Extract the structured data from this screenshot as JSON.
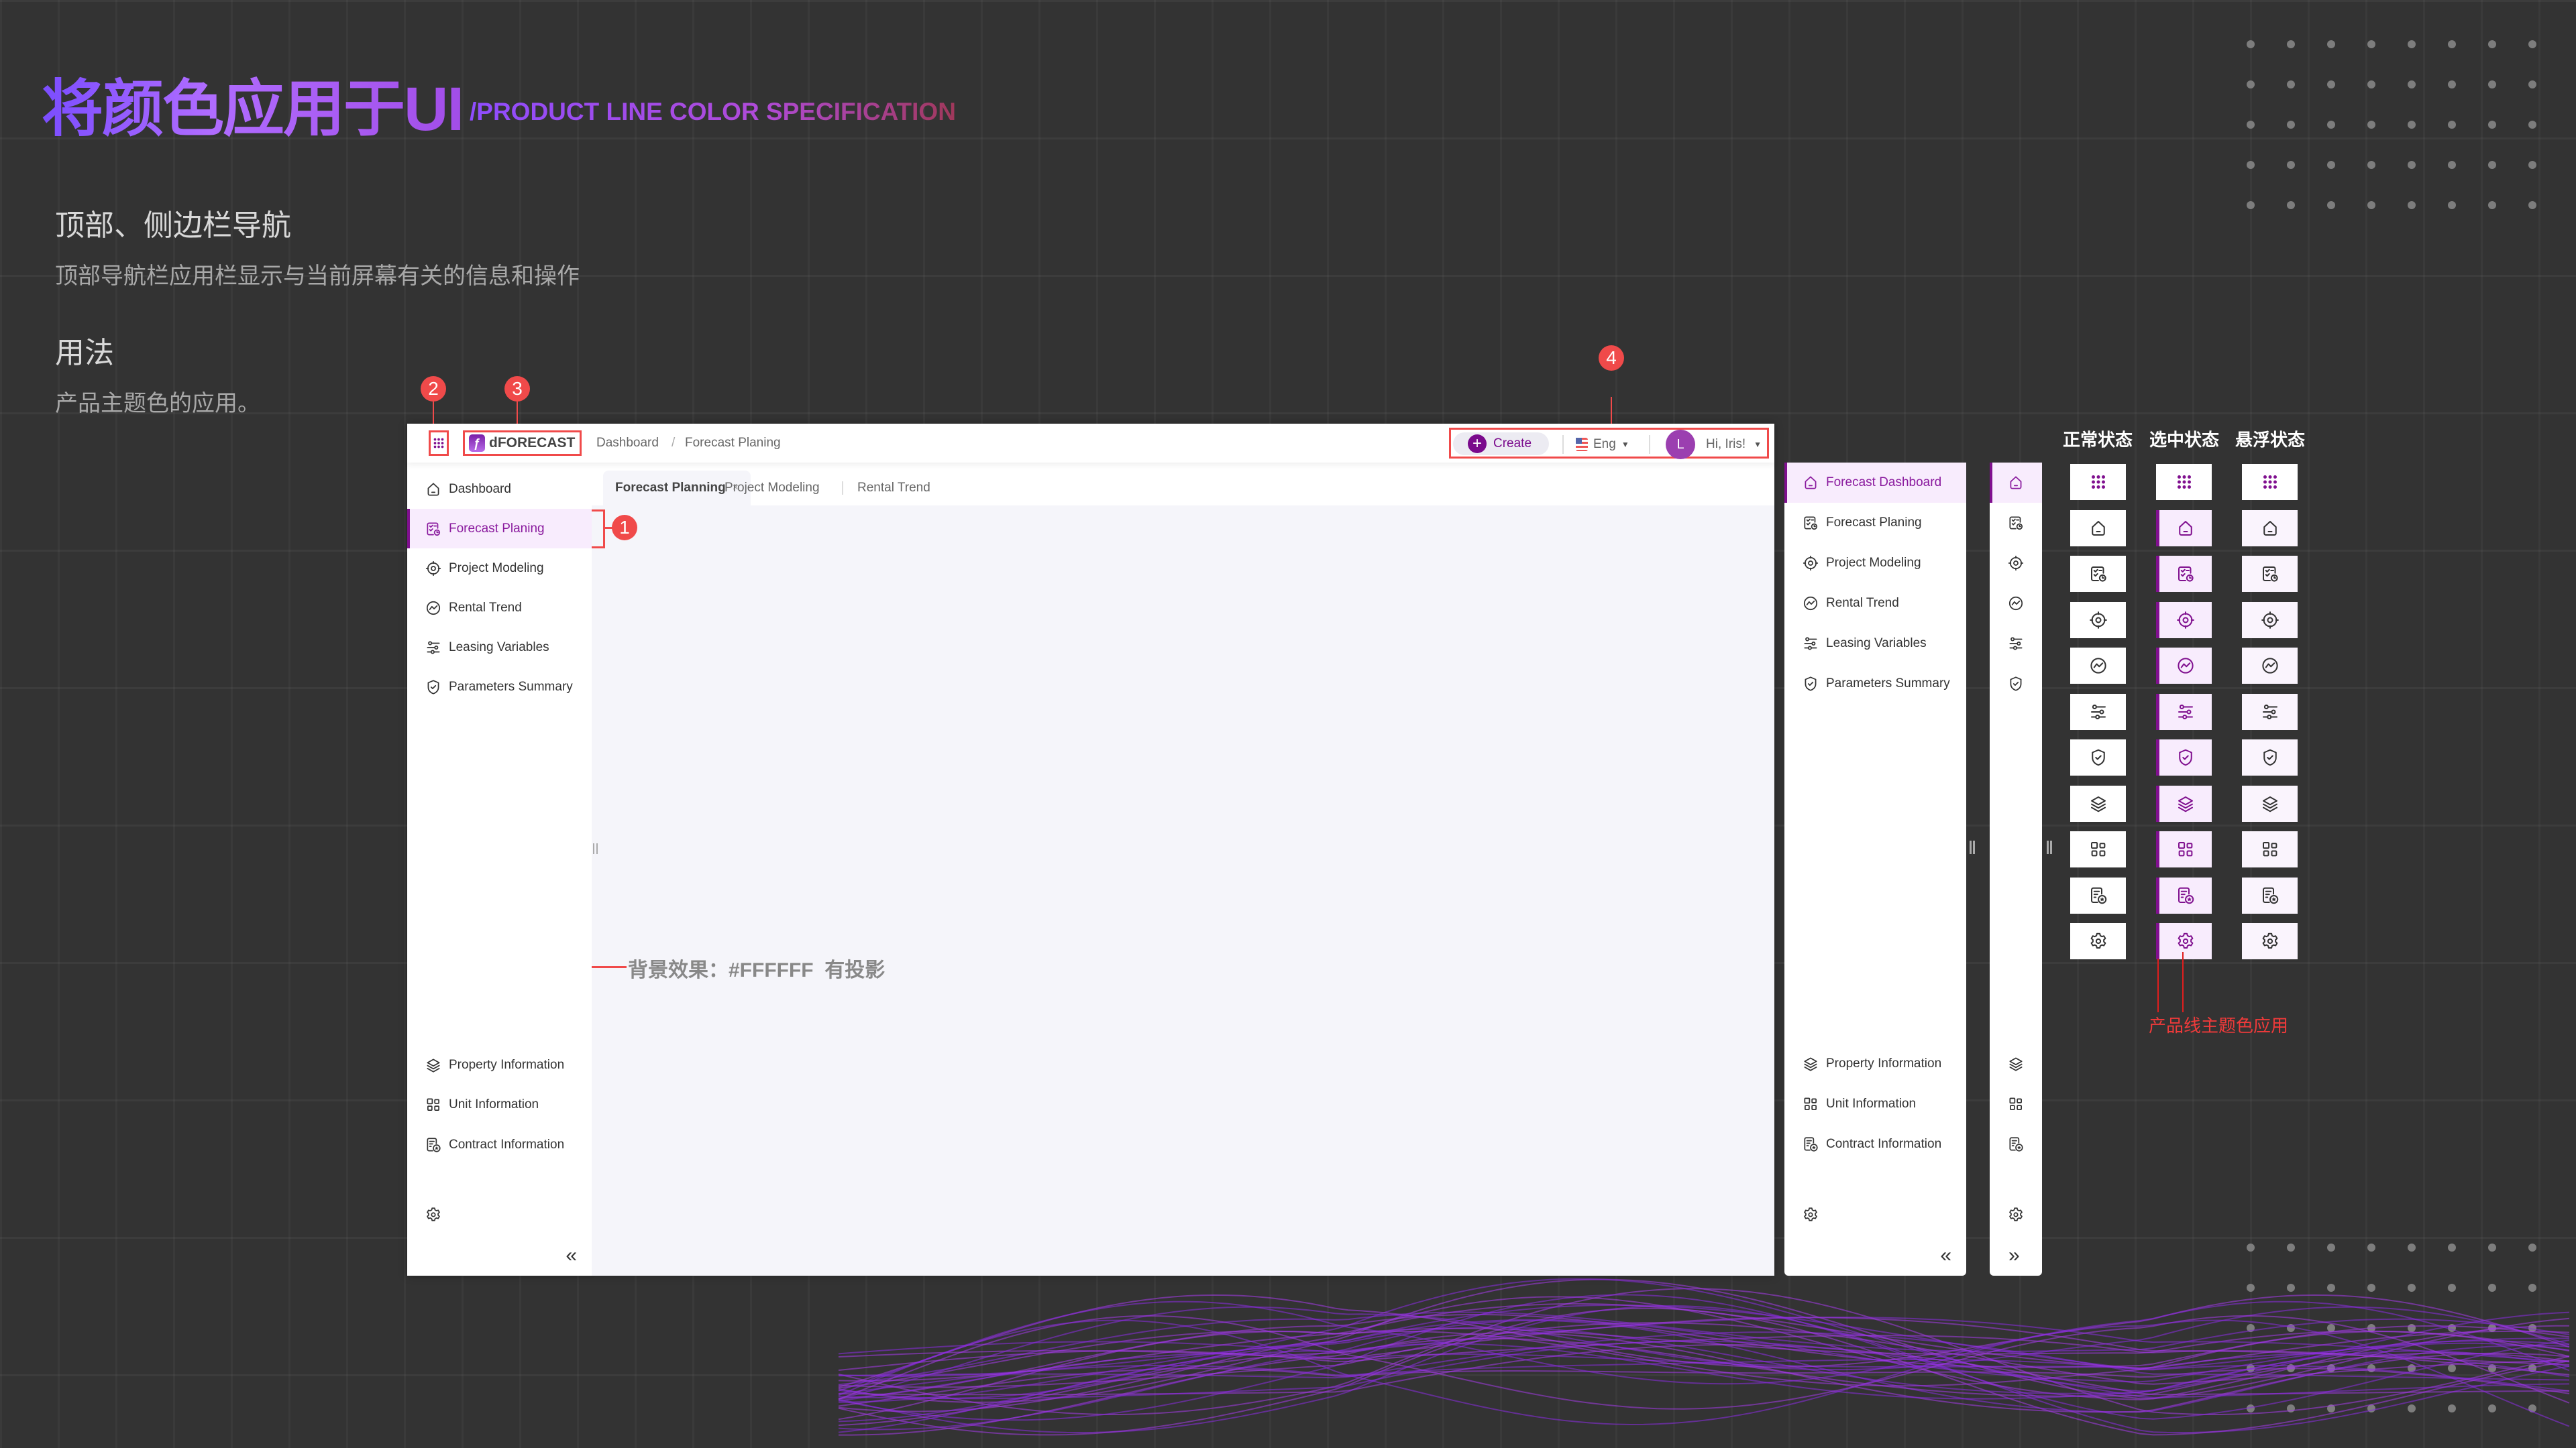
{
  "page": {
    "title": "将颜色应用于UI",
    "subtitle": "/PRODUCT LINE COLOR SPECIFICATION",
    "section_heading": "顶部、侧边栏导航",
    "section_desc": "顶部导航栏应用栏显示与当前屏幕有关的信息和操作",
    "usage_heading": "用法",
    "usage_desc": "产品主题色的应用。",
    "bg_note": "背景效果：#FFFFFF  有投影",
    "theme_note": "产品线主题色应用",
    "badges": [
      "1",
      "2",
      "3",
      "4"
    ]
  },
  "colors": {
    "accent": "#80108F",
    "active_bg": "#F8ECFD",
    "hover_bg": "#FAF4FD",
    "avatar": "#9B3FB0",
    "annotation": "#F04A4A",
    "content_bg": "#F5F5FA"
  },
  "header": {
    "app_name": "dFORECAST",
    "breadcrumb": [
      "Dashboard",
      "/",
      "Forecast Planing"
    ],
    "create_label": "Create",
    "language": "Eng",
    "avatar_initial": "L",
    "greeting": "Hi, Iris!"
  },
  "tabs": [
    {
      "label": "Forecast Planning",
      "close": "×"
    },
    {
      "label": "Project Modeling"
    },
    {
      "label": "Rental Trend"
    }
  ],
  "sidebar_main": {
    "top": [
      {
        "label": "Dashboard",
        "icon": "home"
      },
      {
        "label": "Forecast Planing",
        "icon": "planning",
        "active": true
      },
      {
        "label": "Project Modeling",
        "icon": "target"
      },
      {
        "label": "Rental Trend",
        "icon": "trend"
      },
      {
        "label": "Leasing Variables",
        "icon": "sliders"
      },
      {
        "label": "Parameters Summary",
        "icon": "shield"
      }
    ],
    "bottom": [
      {
        "label": "Property Information",
        "icon": "layers"
      },
      {
        "label": "Unit Information",
        "icon": "grid4"
      },
      {
        "label": "Contract Information",
        "icon": "contract"
      }
    ],
    "collapse": "«"
  },
  "sidebar_alt": {
    "top": [
      {
        "label": "Forecast Dashboard",
        "icon": "home",
        "active": true
      },
      {
        "label": "Forecast Planing",
        "icon": "planning"
      },
      {
        "label": "Project Modeling",
        "icon": "target"
      },
      {
        "label": "Rental Trend",
        "icon": "trend"
      },
      {
        "label": "Leasing Variables",
        "icon": "sliders"
      },
      {
        "label": "Parameters Summary",
        "icon": "shield"
      }
    ],
    "bottom": [
      {
        "label": "Property Information",
        "icon": "layers"
      },
      {
        "label": "Unit Information",
        "icon": "grid4"
      },
      {
        "label": "Contract Information",
        "icon": "contract"
      }
    ],
    "collapse": "«",
    "expand": "»"
  },
  "states": {
    "columns": [
      "正常状态",
      "选中状态",
      "悬浮状态"
    ],
    "icons": [
      "apps",
      "home",
      "planning",
      "target",
      "trend",
      "sliders",
      "shield",
      "layers",
      "grid4",
      "contract",
      "gear"
    ]
  }
}
